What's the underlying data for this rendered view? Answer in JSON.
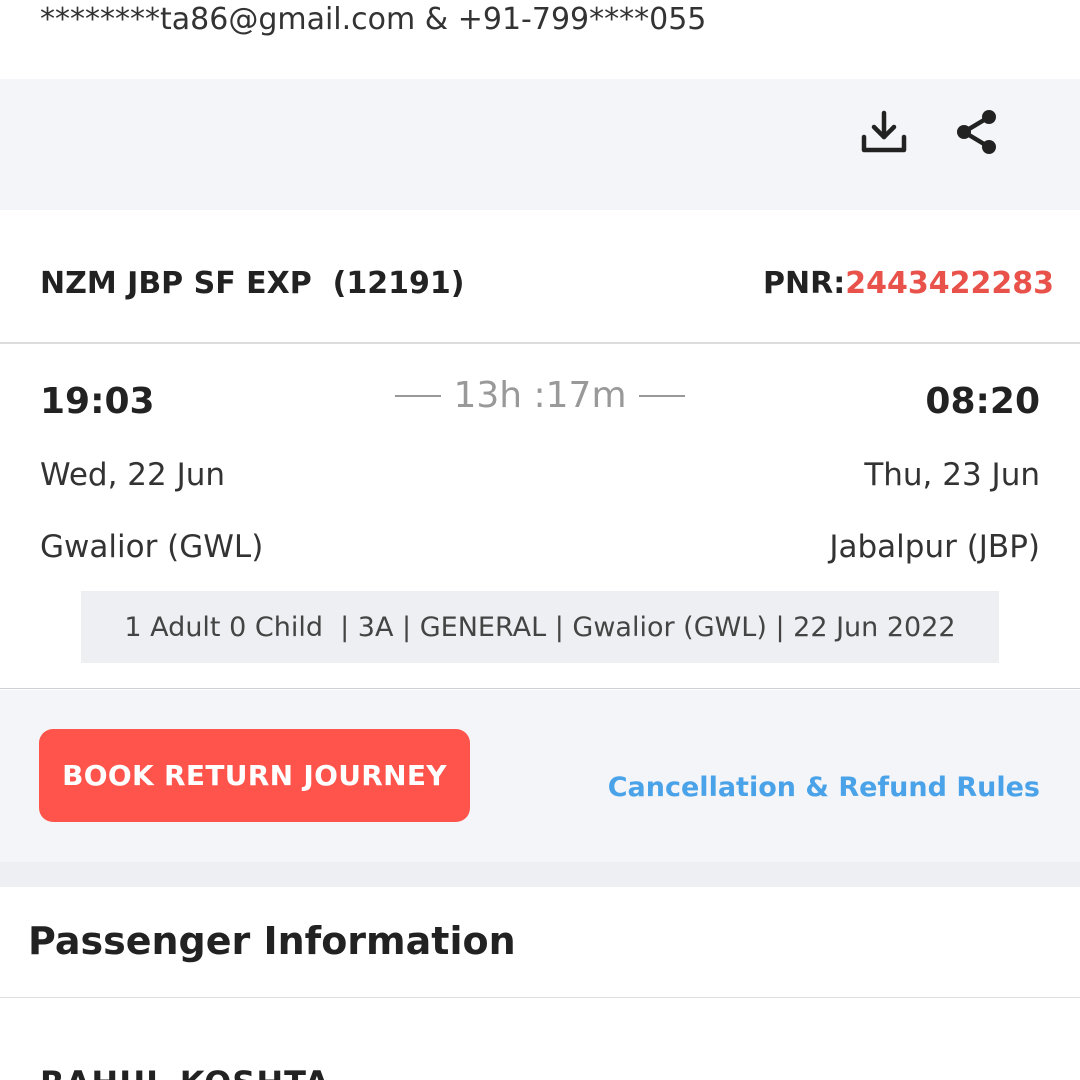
{
  "contact": {
    "text": "********ta86@gmail.com & +91-799****055"
  },
  "actions": {
    "download_icon": "download-icon",
    "share_icon": "share-icon"
  },
  "train": {
    "name": "NZM JBP SF EXP",
    "number": "(12191)",
    "pnr_label": "PNR:",
    "pnr_value": "2443422283"
  },
  "journey": {
    "departure_time": "19:03",
    "arrival_time": "08:20",
    "duration": "13h :17m",
    "departure_date": "Wed, 22 Jun",
    "arrival_date": "Thu, 23 Jun",
    "departure_station": "Gwalior (GWL)",
    "arrival_station": "Jabalpur (JBP)",
    "summary": "1 Adult 0 Child  | 3A | GENERAL | Gwalior (GWL) | 22 Jun 2022"
  },
  "cta": {
    "book_return": "BOOK RETURN JOURNEY",
    "rules": "Cancellation & Refund Rules"
  },
  "passengers": {
    "title": "Passenger Information",
    "first_name": "RAHUL KOSHTA"
  },
  "colors": {
    "accent": "#fe544c",
    "pnr": "#e8524a",
    "link": "#4aa3e8",
    "background_grey": "#f4f5f9"
  }
}
